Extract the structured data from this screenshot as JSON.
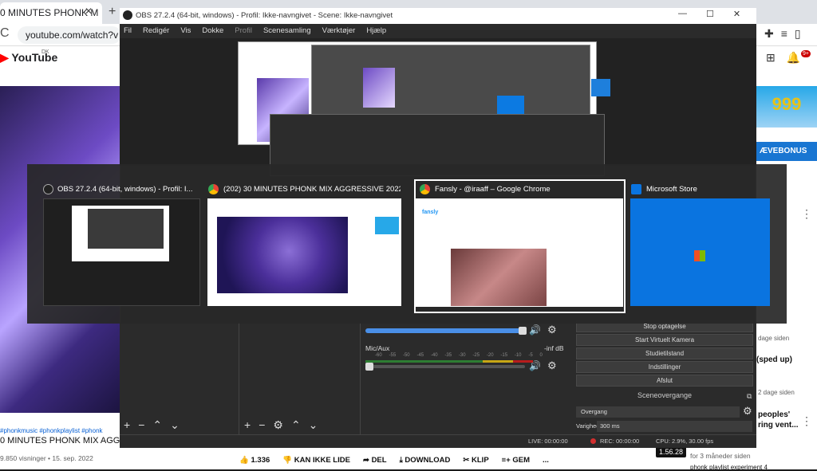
{
  "browser": {
    "tab_title": "0 MINUTES PHONK M",
    "tab_close": "✕",
    "new_tab": "+",
    "reload": "C",
    "url": "youtube.com/watch?v"
  },
  "youtube": {
    "logo": "YouTube",
    "country": "DK",
    "tags": "#phonkmusic #phonkplaylist #phonk",
    "title": "0 MINUTES PHONK MIX AGG",
    "stats": "9.850 visninger • 15. sep. 2022",
    "actions": {
      "like": "1.336",
      "dislike": "KAN IKKE LIDE",
      "share": "DEL",
      "download": "DOWNLOAD",
      "clip": "KLIP",
      "save": "GEM",
      "more": "..."
    },
    "notif_count": "9+",
    "ad_text": "999",
    "bonus_btn": "ÆVEBONUS",
    "side_meta_1": "dage siden",
    "side_title_2": "(sped up)",
    "side_meta_3": "2 dage siden",
    "side_title_4": "peoples'",
    "side_title_5": "ring vent...",
    "side_meta_6": "for 3 måneder siden",
    "side_title_7": "phonk playlist experiment 4",
    "duration_pill": "1.56.28"
  },
  "obs": {
    "title": "OBS 27.2.4 (64-bit, windows) - Profil: Ikke-navngivet - Scene: Ikke-navngivet",
    "menu": [
      "Fil",
      "Redigér",
      "Vis",
      "Dokke",
      "Profil",
      "Scenesamling",
      "Værktøjer",
      "Hjælp"
    ],
    "mic_label": "Mic/Aux",
    "mic_db": "-inf dB",
    "meter_ticks": [
      "-60",
      "-55",
      "-50",
      "-45",
      "-40",
      "-35",
      "-30",
      "-25",
      "-20",
      "-15",
      "-10",
      "-5",
      "0"
    ],
    "buttons": {
      "stop_rec": "Stop optagelse",
      "virtual_cam": "Start Virtuelt Kamera",
      "studio": "Studietilstand",
      "settings": "Indstillinger",
      "exit": "Afslut"
    },
    "scene_transitions": "Sceneovergange",
    "transition": "Overgang",
    "duration_label": "Varighed",
    "duration_value": "300 ms",
    "status": {
      "live": "LIVE: 00:00:00",
      "rec": "REC: 00:00:00",
      "cpu": "CPU: 2.9%, 30.00 fps"
    }
  },
  "switcher": {
    "cards": [
      {
        "title": "OBS 27.2.4 (64-bit, windows) - Profil: I..."
      },
      {
        "title": "(202) 30 MINUTES PHONK MIX AGGRESSIVE 2022 #..."
      },
      {
        "title": "Fansly - @iraaff – Google Chrome"
      },
      {
        "title": "Microsoft Store"
      }
    ],
    "fansly_logo": "fansly"
  },
  "colors": {
    "obs_bg": "#2b2b2b",
    "accent_blue": "#4a8fe7",
    "youtube_red": "#ff0000",
    "ms_store_blue": "#0a74e0"
  }
}
